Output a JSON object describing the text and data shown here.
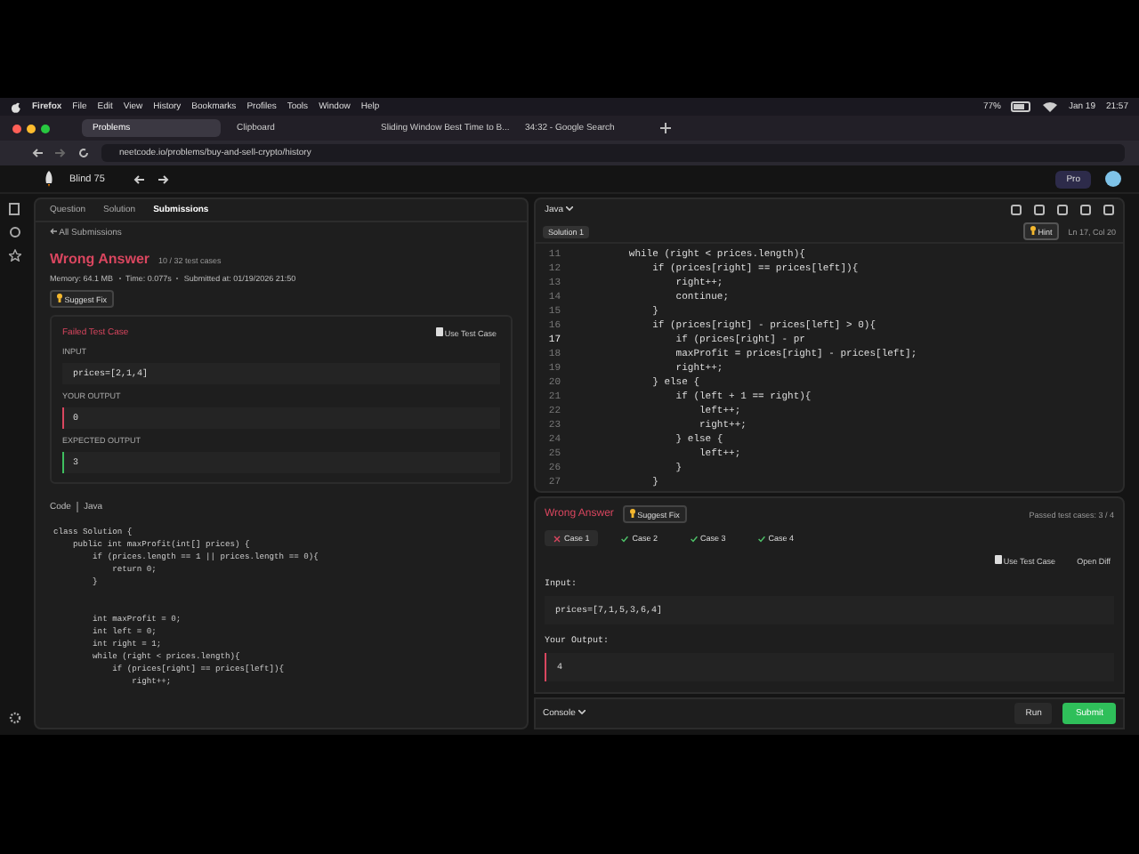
{
  "menu_bar": {
    "app": "Firefox",
    "items": [
      "File",
      "Edit",
      "View",
      "History",
      "Bookmarks",
      "Profiles",
      "Tools",
      "Window",
      "Help"
    ],
    "battery": "77%",
    "date": "Jan 19",
    "time": "21:57"
  },
  "browser_tabs": [
    {
      "title": "Problems",
      "selected": true
    },
    {
      "title": "Clipboard",
      "selected": false
    },
    {
      "title": "Sliding Window Best Time to B...",
      "selected": false
    },
    {
      "title": "34:32 - Google Search",
      "selected": false
    }
  ],
  "address_bar": {
    "url": "neetcode.io/problems/buy-and-sell-crypto/history"
  },
  "app_header": {
    "list": "Blind 75",
    "pro_button": "Pro"
  },
  "left_panel": {
    "tabs": [
      {
        "label": "Question",
        "selected": false
      },
      {
        "label": "Solution",
        "selected": false
      },
      {
        "label": "Submissions",
        "selected": true
      }
    ],
    "back_link": "All Submissions",
    "result": {
      "status": "Wrong Answer",
      "tests": "10 / 32 test cases",
      "memory": "Memory: 64.1 MB",
      "time": "Time: 0.077s",
      "submitted": "Submitted at: 01/19/2026 21:50"
    },
    "suggest_fix": "Suggest Fix",
    "failed_case": {
      "title": "Failed Test Case",
      "use_button": "Use Test Case",
      "sections": [
        {
          "label": "INPUT",
          "value": "prices=[2,1,4]",
          "kind": "plain"
        },
        {
          "label": "YOUR OUTPUT",
          "value": "0",
          "kind": "wrong"
        },
        {
          "label": "EXPECTED OUTPUT",
          "value": "3",
          "kind": "expected"
        }
      ]
    },
    "code_header": {
      "title": "Code",
      "language": "Java"
    },
    "code": "class Solution {\n    public int maxProfit(int[] prices) {\n        if (prices.length == 1 || prices.length == 0){\n            return 0;\n        }\n\n\n        int maxProfit = 0;\n        int left = 0;\n        int right = 1;\n        while (right < prices.length){\n            if (prices[right] == prices[left]){\n                right++;"
  },
  "editor": {
    "language": "Java",
    "tabs": [
      {
        "label": "Solution 1",
        "selected": true
      }
    ],
    "hint_button": "Hint",
    "cursor": "Ln 17, Col 20",
    "lines": [
      {
        "number": "11",
        "text": "        while (right < prices.length){",
        "active": false
      },
      {
        "number": "12",
        "text": "            if (prices[right] == prices[left]){",
        "active": false
      },
      {
        "number": "13",
        "text": "                right++;",
        "active": false
      },
      {
        "number": "14",
        "text": "                continue;",
        "active": false
      },
      {
        "number": "15",
        "text": "            }",
        "active": false
      },
      {
        "number": "16",
        "text": "            if (prices[right] - prices[left] > 0){",
        "active": false
      },
      {
        "number": "17",
        "text": "                if (prices[right] - pr",
        "active": true
      },
      {
        "number": "18",
        "text": "                maxProfit = prices[right] - prices[left];",
        "active": false
      },
      {
        "number": "19",
        "text": "                right++;",
        "active": false
      },
      {
        "number": "20",
        "text": "            } else {",
        "active": false
      },
      {
        "number": "21",
        "text": "                if (left + 1 == right){",
        "active": false
      },
      {
        "number": "22",
        "text": "                    left++;",
        "active": false
      },
      {
        "number": "23",
        "text": "                    right++;",
        "active": false
      },
      {
        "number": "24",
        "text": "                } else {",
        "active": false
      },
      {
        "number": "25",
        "text": "                    left++;",
        "active": false
      },
      {
        "number": "26",
        "text": "                }",
        "active": false
      },
      {
        "number": "27",
        "text": "            }",
        "active": false
      }
    ]
  },
  "results": {
    "status": "Wrong Answer",
    "suggest_fix": "Suggest Fix",
    "passed": "Passed test cases: 3 / 4",
    "cases": [
      {
        "label": "Case 1",
        "passed": false,
        "selected": true
      },
      {
        "label": "Case 2",
        "passed": true,
        "selected": false
      },
      {
        "label": "Case 3",
        "passed": true,
        "selected": false
      },
      {
        "label": "Case 4",
        "passed": true,
        "selected": false
      }
    ],
    "use_button": "Use Test Case",
    "diff_button": "Open Diff",
    "input_label": "Input:",
    "input": "prices=[7,1,5,3,6,4]",
    "output_label": "Your Output:",
    "output": "4"
  },
  "footer": {
    "console": "Console",
    "run": "Run",
    "submit": "Submit"
  }
}
